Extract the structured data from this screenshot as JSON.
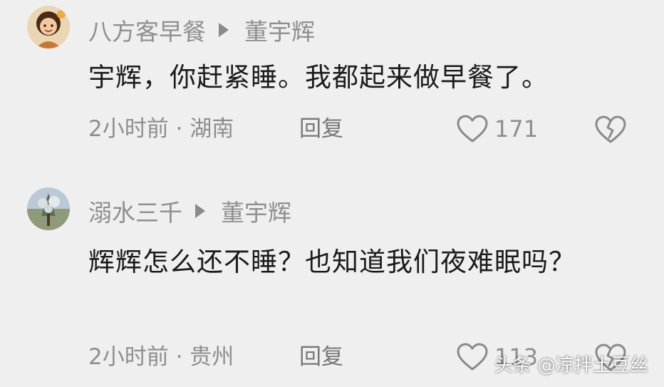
{
  "comments": [
    {
      "username": "八方客早餐",
      "reply_to": "董宇辉",
      "text": "宇辉，你赶紧睡。我都起来做早餐了。",
      "time_location": "2小时前 · 湖南",
      "reply_label": "回复",
      "like_count": "171"
    },
    {
      "username": "溺水三千",
      "reply_to": "董宇辉",
      "text": "辉辉怎么还不睡？也知道我们夜难眠吗？",
      "time_location": "2小时前 · 贵州",
      "reply_label": "回复",
      "like_count": "113"
    }
  ],
  "watermark": "头条 @凉拌土豆丝",
  "colors": {
    "background": "#efefef",
    "username": "#8f8f8f",
    "body_text": "#1b1b1b",
    "meta_text": "#8e8e8e"
  },
  "icons": [
    "reply-to-arrow-icon",
    "heart-like-icon",
    "broken-heart-dislike-icon"
  ]
}
